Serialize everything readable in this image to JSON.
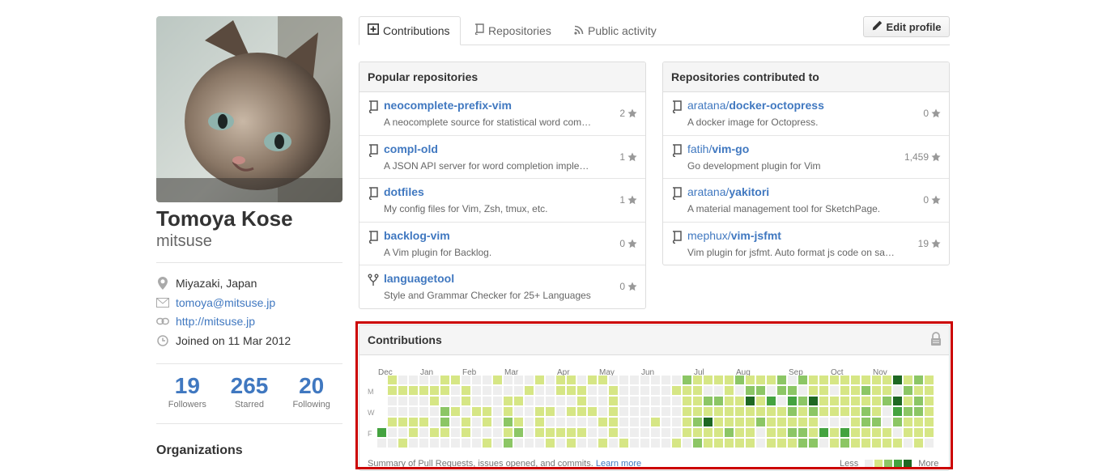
{
  "profile": {
    "fullname": "Tomoya Kose",
    "username": "mitsuse",
    "location": "Miyazaki, Japan",
    "email": "tomoya@mitsuse.jp",
    "url": "http://mitsuse.jp",
    "joined_prefix": "Joined on",
    "joined_date": "11 Mar 2012"
  },
  "stats": [
    {
      "num": "19",
      "label": "Followers"
    },
    {
      "num": "265",
      "label": "Starred"
    },
    {
      "num": "20",
      "label": "Following"
    }
  ],
  "orgs_title": "Organizations",
  "tabs": [
    {
      "label": "Contributions",
      "icon": "plus-square-icon"
    },
    {
      "label": "Repositories",
      "icon": "repo-icon"
    },
    {
      "label": "Public activity",
      "icon": "rss-icon"
    }
  ],
  "edit_profile": "Edit profile",
  "popular": {
    "title": "Popular repositories",
    "repos": [
      {
        "name": "neocomplete-prefix-vim",
        "desc": "A neocomplete source for statistical word com…",
        "stars": "2",
        "icon": "repo-icon"
      },
      {
        "name": "compl-old",
        "desc": "A JSON API server for word completion imple…",
        "stars": "1",
        "icon": "repo-icon"
      },
      {
        "name": "dotfiles",
        "desc": "My config files for Vim, Zsh, tmux, etc.",
        "stars": "1",
        "icon": "repo-icon"
      },
      {
        "name": "backlog-vim",
        "desc": "A Vim plugin for Backlog.",
        "stars": "0",
        "icon": "repo-icon"
      },
      {
        "name": "languagetool",
        "desc": "Style and Grammar Checker for 25+ Languages",
        "stars": "0",
        "icon": "fork-icon"
      }
    ]
  },
  "contributed": {
    "title": "Repositories contributed to",
    "repos": [
      {
        "owner": "aratana/",
        "name": "docker-octopress",
        "desc": "A docker image for Octopress.",
        "stars": "0"
      },
      {
        "owner": "fatih/",
        "name": "vim-go",
        "desc": "Go development plugin for Vim",
        "stars": "1,459"
      },
      {
        "owner": "aratana/",
        "name": "yakitori",
        "desc": "A material management tool for SketchPage.",
        "stars": "0"
      },
      {
        "owner": "mephux/",
        "name": "vim-jsfmt",
        "desc": "Vim plugin for jsfmt. Auto format js code on sa…",
        "stars": "19"
      }
    ]
  },
  "contributions": {
    "title": "Contributions",
    "months": [
      "Dec",
      "Jan",
      "Feb",
      "Mar",
      "Apr",
      "May",
      "Jun",
      "Jul",
      "Aug",
      "Sep",
      "Oct",
      "Nov"
    ],
    "days": [
      "M",
      "W",
      "F"
    ],
    "summary": "Summary of Pull Requests, issues opened, and commits.",
    "learn_more": "Learn more",
    "less": "Less",
    "more": "More",
    "colors": [
      "#eeeeee",
      "#d6e685",
      "#8cc665",
      "#44a340",
      "#1e6823"
    ]
  }
}
